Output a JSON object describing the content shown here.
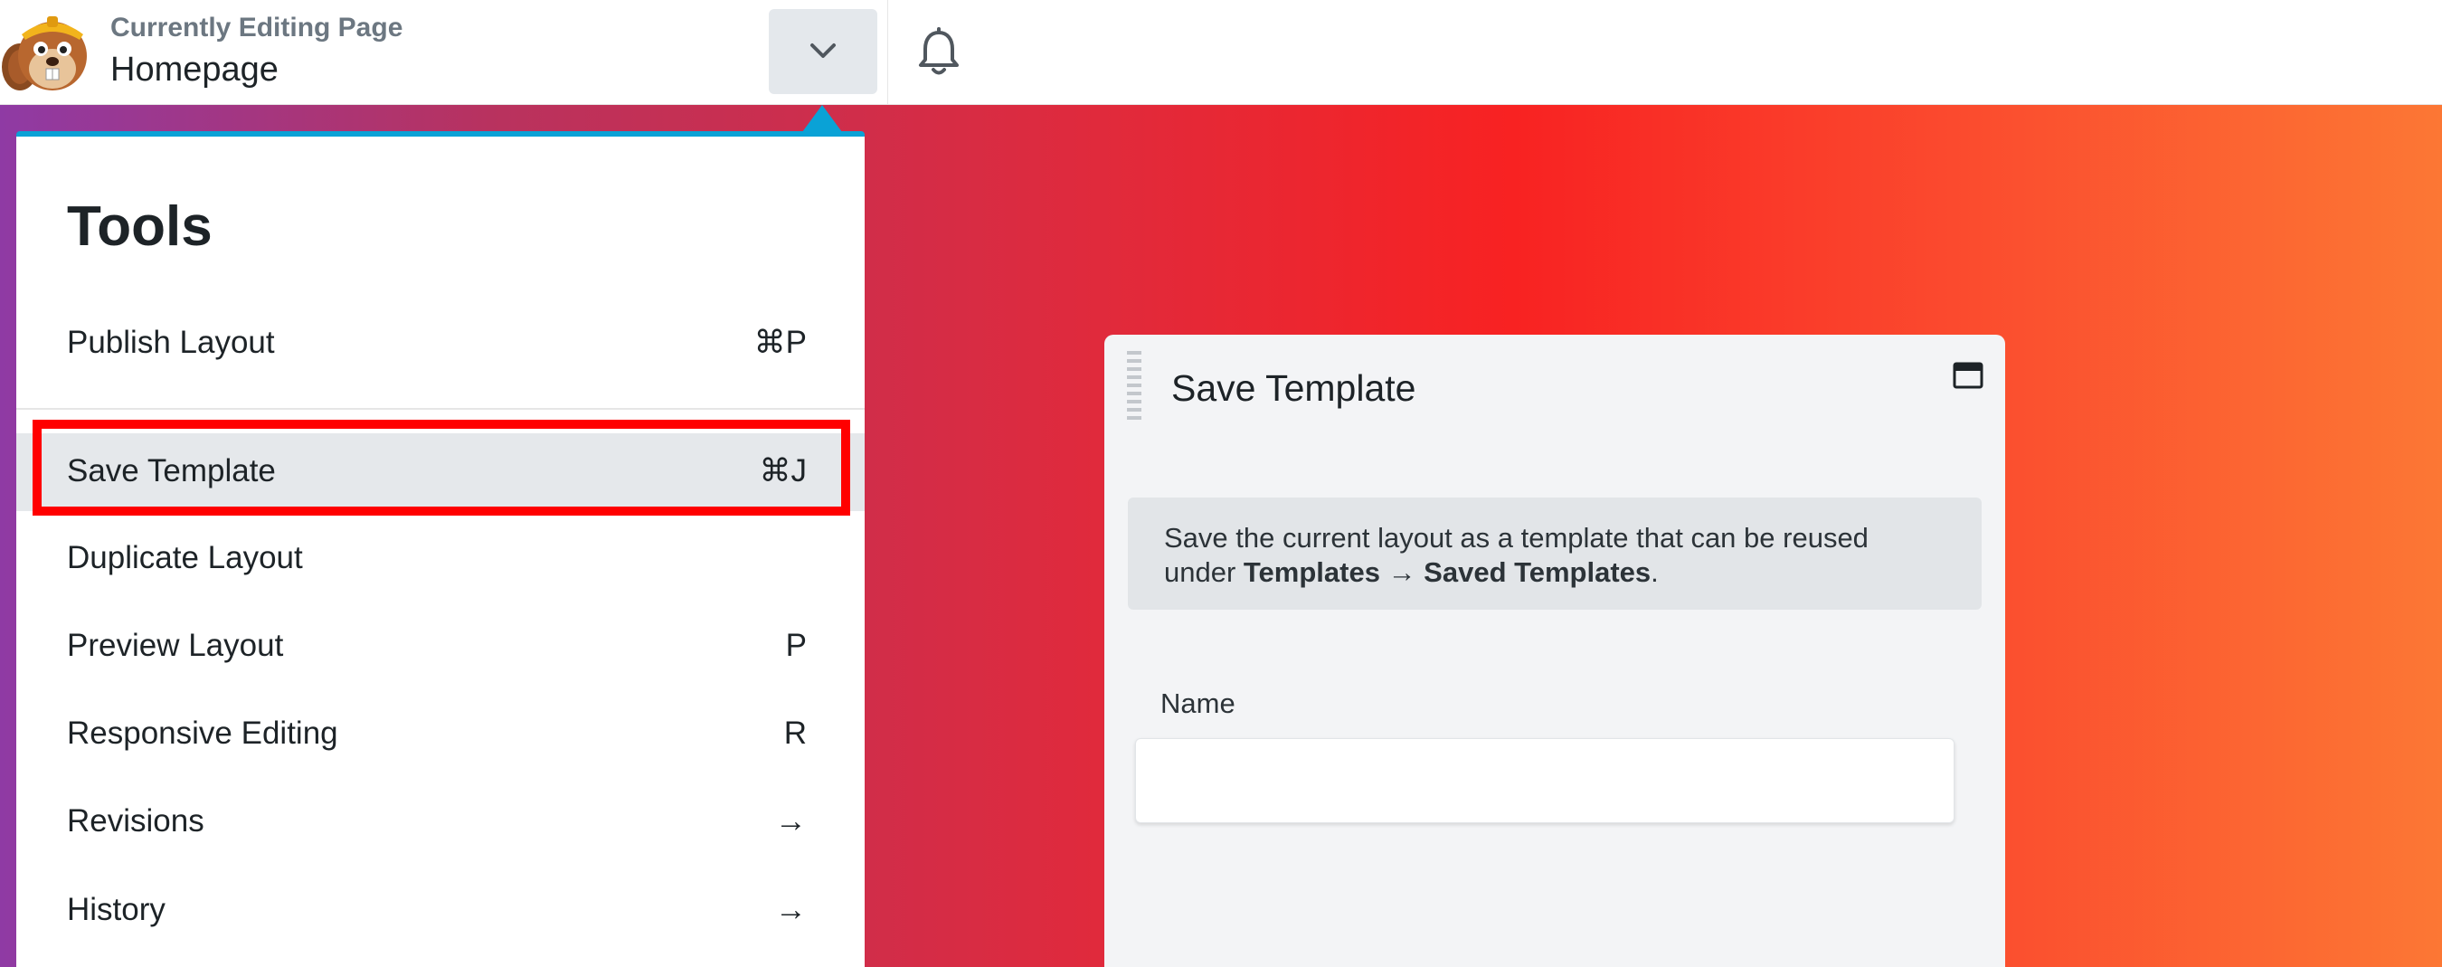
{
  "header": {
    "caption": "Currently Editing Page",
    "page_name": "Homepage",
    "icons": {
      "logo": "beaver-logo",
      "toggle": "chevron-down-icon",
      "notifications": "bell-icon"
    }
  },
  "tools_menu": {
    "title": "Tools",
    "accent_color": "#0aa2d6",
    "items": [
      {
        "label": "Publish Layout",
        "shortcut": "⌘P"
      },
      {
        "label": "Save Template",
        "shortcut": "⌘J",
        "highlighted": true
      },
      {
        "label": "Duplicate Layout",
        "shortcut": ""
      },
      {
        "label": "Preview Layout",
        "shortcut": "P"
      },
      {
        "label": "Responsive Editing",
        "shortcut": "R"
      },
      {
        "label": "Revisions",
        "shortcut": "→"
      },
      {
        "label": "History",
        "shortcut": "→"
      }
    ]
  },
  "dialog": {
    "title": "Save Template",
    "notice_text": "Save the current layout as a template that can be reused under",
    "notice_path": "Templates → Saved Templates",
    "notice_end": ".",
    "name_label": "Name",
    "name_value": ""
  },
  "colors": {
    "annotation_outline": "#ff0000",
    "canvas_gradient": [
      "#8f3aa4",
      "#e02a3c",
      "#f82222",
      "#fc7734"
    ]
  }
}
